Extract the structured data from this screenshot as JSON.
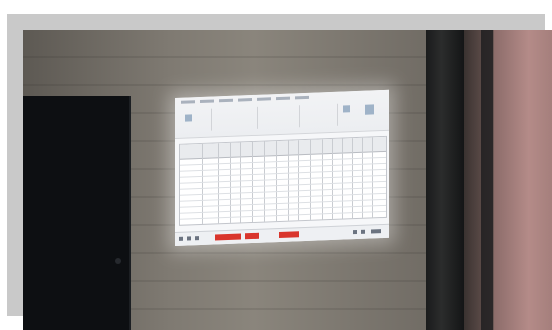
{
  "scene": {
    "description_items": [
      "wall-projection",
      "door",
      "pillar"
    ]
  },
  "colors": {
    "wall": "#7f7a72",
    "door": "#0d0f12",
    "projection_bg": "#f6f7f9",
    "taskbar_accent": "#d9352c",
    "pink_wall": "#b48b88"
  }
}
